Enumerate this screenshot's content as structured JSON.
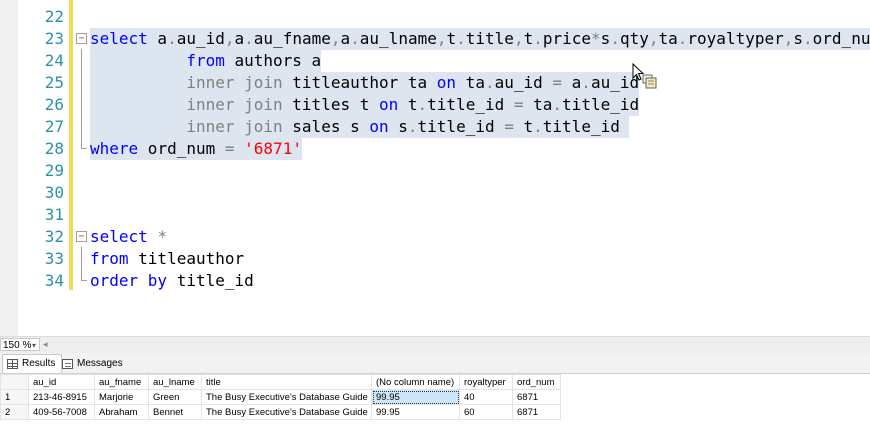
{
  "editor": {
    "lines": [
      {
        "num": "22",
        "tokens": []
      },
      {
        "num": "23",
        "tokens": [
          {
            "t": "select",
            "c": "kw"
          },
          {
            "t": " a",
            "c": ""
          },
          {
            "t": ".",
            "c": "gr"
          },
          {
            "t": "au_id",
            "c": ""
          },
          {
            "t": ",",
            "c": "gr"
          },
          {
            "t": "a",
            "c": ""
          },
          {
            "t": ".",
            "c": "gr"
          },
          {
            "t": "au_fname",
            "c": ""
          },
          {
            "t": ",",
            "c": "gr"
          },
          {
            "t": "a",
            "c": ""
          },
          {
            "t": ".",
            "c": "gr"
          },
          {
            "t": "au_lname",
            "c": ""
          },
          {
            "t": ",",
            "c": "gr"
          },
          {
            "t": "t",
            "c": ""
          },
          {
            "t": ".",
            "c": "gr"
          },
          {
            "t": "title",
            "c": ""
          },
          {
            "t": ",",
            "c": "gr"
          },
          {
            "t": "t",
            "c": ""
          },
          {
            "t": ".",
            "c": "gr"
          },
          {
            "t": "price",
            "c": ""
          },
          {
            "t": "*",
            "c": "gr"
          },
          {
            "t": "s",
            "c": ""
          },
          {
            "t": ".",
            "c": "gr"
          },
          {
            "t": "qty",
            "c": ""
          },
          {
            "t": ",",
            "c": "gr"
          },
          {
            "t": "ta",
            "c": ""
          },
          {
            "t": ".",
            "c": "gr"
          },
          {
            "t": "royaltyper",
            "c": ""
          },
          {
            "t": ",",
            "c": "gr"
          },
          {
            "t": "s",
            "c": ""
          },
          {
            "t": ".",
            "c": "gr"
          },
          {
            "t": "ord_num",
            "c": ""
          }
        ]
      },
      {
        "num": "24",
        "tokens": [
          {
            "t": "          ",
            "c": ""
          },
          {
            "t": "from",
            "c": "kw"
          },
          {
            "t": " authors a",
            "c": ""
          }
        ]
      },
      {
        "num": "25",
        "tokens": [
          {
            "t": "          ",
            "c": ""
          },
          {
            "t": "inner join",
            "c": "gr"
          },
          {
            "t": " titleauthor ta ",
            "c": ""
          },
          {
            "t": "on",
            "c": "kw"
          },
          {
            "t": " ta",
            "c": ""
          },
          {
            "t": ".",
            "c": "gr"
          },
          {
            "t": "au_id ",
            "c": ""
          },
          {
            "t": "=",
            "c": "gr"
          },
          {
            "t": " a",
            "c": ""
          },
          {
            "t": ".",
            "c": "gr"
          },
          {
            "t": "au_id",
            "c": ""
          }
        ]
      },
      {
        "num": "26",
        "tokens": [
          {
            "t": "          ",
            "c": ""
          },
          {
            "t": "inner join",
            "c": "gr"
          },
          {
            "t": " titles t ",
            "c": ""
          },
          {
            "t": "on",
            "c": "kw"
          },
          {
            "t": " t",
            "c": ""
          },
          {
            "t": ".",
            "c": "gr"
          },
          {
            "t": "title_id ",
            "c": ""
          },
          {
            "t": "=",
            "c": "gr"
          },
          {
            "t": " ta",
            "c": ""
          },
          {
            "t": ".",
            "c": "gr"
          },
          {
            "t": "title_id",
            "c": ""
          }
        ]
      },
      {
        "num": "27",
        "tokens": [
          {
            "t": "          ",
            "c": ""
          },
          {
            "t": "inner join",
            "c": "gr"
          },
          {
            "t": " sales s ",
            "c": ""
          },
          {
            "t": "on",
            "c": "kw"
          },
          {
            "t": " s",
            "c": ""
          },
          {
            "t": ".",
            "c": "gr"
          },
          {
            "t": "title_id ",
            "c": ""
          },
          {
            "t": "=",
            "c": "gr"
          },
          {
            "t": " t",
            "c": ""
          },
          {
            "t": ".",
            "c": "gr"
          },
          {
            "t": "title_id ",
            "c": ""
          }
        ]
      },
      {
        "num": "28",
        "tokens": [
          {
            "t": "where",
            "c": "kw"
          },
          {
            "t": " ord_num ",
            "c": ""
          },
          {
            "t": "=",
            "c": "gr"
          },
          {
            "t": " ",
            "c": ""
          },
          {
            "t": "'6871'",
            "c": "str"
          }
        ]
      },
      {
        "num": "29",
        "tokens": []
      },
      {
        "num": "30",
        "tokens": []
      },
      {
        "num": "31",
        "tokens": []
      },
      {
        "num": "32",
        "tokens": [
          {
            "t": "select",
            "c": "kw"
          },
          {
            "t": " ",
            "c": ""
          },
          {
            "t": "*",
            "c": "gr"
          }
        ]
      },
      {
        "num": "33",
        "tokens": [
          {
            "t": "from",
            "c": "kw"
          },
          {
            "t": " titleauthor",
            "c": ""
          }
        ]
      },
      {
        "num": "34",
        "tokens": [
          {
            "t": "order by",
            "c": "kw"
          },
          {
            "t": " title_id",
            "c": ""
          }
        ]
      }
    ]
  },
  "zoom": {
    "value": "150 %"
  },
  "tabs": {
    "results_label": "Results",
    "messages_label": "Messages"
  },
  "results": {
    "columns": [
      "au_id",
      "au_fname",
      "au_lname",
      "title",
      "(No column name)",
      "royaltyper",
      "ord_num"
    ],
    "rows": [
      {
        "rn": "1",
        "cells": [
          "213-46-8915",
          "Marjorie",
          "Green",
          "The Busy Executive's Database Guide",
          "99.95",
          "40",
          "6871"
        ]
      },
      {
        "rn": "2",
        "cells": [
          "409-56-7008",
          "Abraham",
          "Bennet",
          "The Busy Executive's Database Guide",
          "99.95",
          "60",
          "6871"
        ]
      }
    ]
  },
  "colors": {
    "keyword": "#0000ff",
    "operator": "#808080",
    "string": "#ff0000",
    "line_number": "#2b91af",
    "selection": "#dde5f0",
    "change_bar": "#f4d95a"
  }
}
